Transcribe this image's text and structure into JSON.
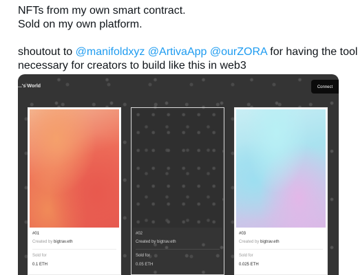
{
  "tweet": {
    "line1": "NFTs from my own smart contract.",
    "line2": "Sold on my own platform.",
    "line3_prefix": "shoutout to ",
    "mentions": [
      "@manifoldxyz",
      "@ArtivaApp",
      "@ourZORA"
    ],
    "line3_suffix": " for having the tools",
    "line4": "necessary for creators to build like this in web3"
  },
  "site": {
    "title": "...'s World",
    "connect_label": "Connect"
  },
  "nfts": [
    {
      "token": "#01",
      "created_by_prefix": "Created by",
      "creator": "bigtrav.eth",
      "sold_label": "Sold for",
      "price": "0.1 ETH"
    },
    {
      "token": "#02",
      "created_by_prefix": "Created by",
      "creator": "bigtrav.eth",
      "sold_label": "Sold for",
      "price": "0.05 ETH"
    },
    {
      "token": "#03",
      "created_by_prefix": "Created by",
      "creator": "bigtrav.eth",
      "sold_label": "Sold for",
      "price": "0.025 ETH"
    }
  ]
}
